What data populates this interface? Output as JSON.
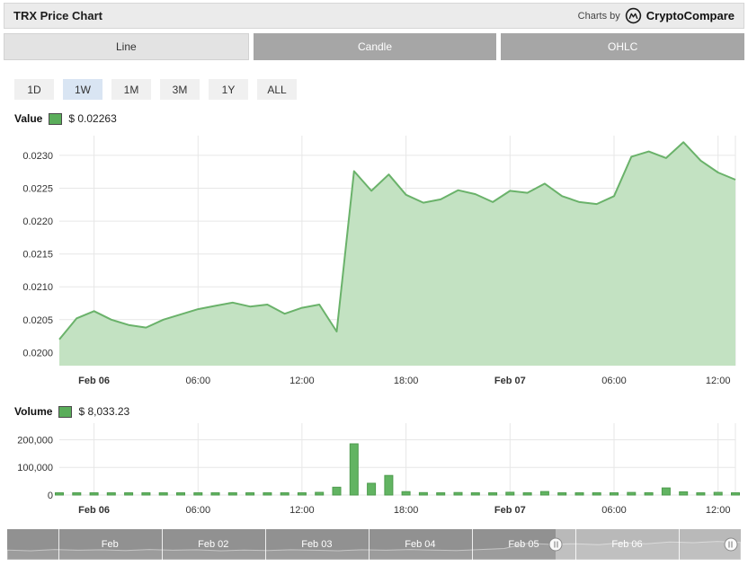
{
  "header": {
    "title": "TRX Price Chart",
    "charts_by": "Charts by",
    "brand": "CryptoCompare"
  },
  "tabs": [
    {
      "label": "Line",
      "active": true
    },
    {
      "label": "Candle",
      "active": false
    },
    {
      "label": "OHLC",
      "active": false
    }
  ],
  "ranges": [
    {
      "label": "1D",
      "selected": false
    },
    {
      "label": "1W",
      "selected": true
    },
    {
      "label": "1M",
      "selected": false
    },
    {
      "label": "3M",
      "selected": false
    },
    {
      "label": "1Y",
      "selected": false
    },
    {
      "label": "ALL",
      "selected": false
    }
  ],
  "price_legend": {
    "label": "Value",
    "value": "$ 0.02263"
  },
  "volume_legend": {
    "label": "Volume",
    "value": "$ 8,033.23"
  },
  "colors": {
    "line": "#6ab26a",
    "area_fill": "#c3e2c2",
    "bar_fill": "#62b462",
    "bar_border": "#4d9b4d",
    "swatch": "#5aad5a",
    "grid": "#e7e7e7",
    "range_selected_bg": "#d9e5f3"
  },
  "chart_data": [
    {
      "type": "area",
      "title": "TRX price (USD)",
      "legend": "Value",
      "x": [
        "Feb 05 22:00",
        "Feb 05 23:00",
        "Feb 06 00:00",
        "01:00",
        "02:00",
        "03:00",
        "04:00",
        "05:00",
        "06:00",
        "07:00",
        "08:00",
        "09:00",
        "10:00",
        "11:00",
        "12:00",
        "13:00",
        "14:00",
        "15:00",
        "16:00",
        "17:00",
        "18:00",
        "19:00",
        "20:00",
        "21:00",
        "22:00",
        "23:00",
        "Feb 07 00:00",
        "01:00",
        "02:00",
        "03:00",
        "04:00",
        "05:00",
        "06:00",
        "07:00",
        "08:00",
        "09:00",
        "10:00",
        "11:00",
        "12:00",
        "13:00"
      ],
      "values": [
        0.0202,
        0.02052,
        0.02063,
        0.0205,
        0.02042,
        0.02038,
        0.0205,
        0.02058,
        0.02066,
        0.02071,
        0.02076,
        0.0207,
        0.02073,
        0.02059,
        0.02068,
        0.02073,
        0.02032,
        0.02276,
        0.02246,
        0.02271,
        0.0224,
        0.02228,
        0.02233,
        0.02247,
        0.02241,
        0.02229,
        0.02246,
        0.02243,
        0.02257,
        0.02238,
        0.02229,
        0.02226,
        0.02238,
        0.02298,
        0.02306,
        0.02296,
        0.0232,
        0.02292,
        0.02274,
        0.02263
      ],
      "ylim": [
        0.0198,
        0.0233
      ],
      "yticks": [
        0.02,
        0.0205,
        0.021,
        0.0215,
        0.022,
        0.0225,
        0.023
      ],
      "xticks": [
        {
          "i": 2,
          "label": "Feb 06",
          "bold": true
        },
        {
          "i": 8,
          "label": "06:00",
          "bold": false
        },
        {
          "i": 14,
          "label": "12:00",
          "bold": false
        },
        {
          "i": 20,
          "label": "18:00",
          "bold": false
        },
        {
          "i": 26,
          "label": "Feb 07",
          "bold": true
        },
        {
          "i": 32,
          "label": "06:00",
          "bold": false
        },
        {
          "i": 38,
          "label": "12:00",
          "bold": false
        }
      ],
      "grid": true
    },
    {
      "type": "bar",
      "title": "Volume (USD)",
      "legend": "Volume",
      "x": [
        "Feb 05 22:00",
        "Feb 05 23:00",
        "Feb 06 00:00",
        "01:00",
        "02:00",
        "03:00",
        "04:00",
        "05:00",
        "06:00",
        "07:00",
        "08:00",
        "09:00",
        "10:00",
        "11:00",
        "12:00",
        "13:00",
        "14:00",
        "15:00",
        "16:00",
        "17:00",
        "18:00",
        "19:00",
        "20:00",
        "21:00",
        "22:00",
        "23:00",
        "Feb 07 00:00",
        "01:00",
        "02:00",
        "03:00",
        "04:00",
        "05:00",
        "06:00",
        "07:00",
        "08:00",
        "09:00",
        "10:00",
        "11:00",
        "12:00",
        "13:00"
      ],
      "values": [
        4800,
        6200,
        8100,
        5300,
        7700,
        4100,
        3500,
        5900,
        4700,
        3300,
        6000,
        4400,
        7100,
        5200,
        4900,
        9700,
        28400,
        185300,
        42600,
        70900,
        12300,
        8700,
        6100,
        9200,
        7400,
        5700,
        10100,
        6800,
        12700,
        7600,
        4200,
        3900,
        6900,
        9500,
        8300,
        25600,
        11800,
        7500,
        9600,
        8033.23
      ],
      "ylim": [
        0,
        260000
      ],
      "yticks": [
        0,
        100000,
        200000
      ],
      "xticks": [
        {
          "i": 2,
          "label": "Feb 06",
          "bold": true
        },
        {
          "i": 8,
          "label": "06:00",
          "bold": false
        },
        {
          "i": 14,
          "label": "12:00",
          "bold": false
        },
        {
          "i": 20,
          "label": "18:00",
          "bold": false
        },
        {
          "i": 26,
          "label": "Feb 07",
          "bold": true
        },
        {
          "i": 32,
          "label": "06:00",
          "bold": false
        },
        {
          "i": 38,
          "label": "12:00",
          "bold": false
        }
      ],
      "grid": true
    }
  ],
  "navigator": {
    "labels": [
      "Feb",
      "Feb 02",
      "Feb 03",
      "Feb 04",
      "Feb 05",
      "Feb 06"
    ],
    "label_pcts": [
      14,
      28.1,
      42.2,
      56.3,
      70.4,
      84.5
    ],
    "divider_pcts": [
      7.0,
      21.1,
      35.2,
      49.3,
      63.4,
      77.5,
      91.6
    ],
    "selected_start_pct": 74.8,
    "handle_pcts": [
      74.8,
      98.6
    ],
    "sparkline": [
      0.28,
      0.25,
      0.3,
      0.27,
      0.29,
      0.26,
      0.3,
      0.27,
      0.29,
      0.25,
      0.28,
      0.26,
      0.29,
      0.27,
      0.25,
      0.29,
      0.27,
      0.3,
      0.28,
      0.26,
      0.3,
      0.34,
      0.55,
      0.5,
      0.53,
      0.49,
      0.57,
      0.53,
      0.6,
      0.57,
      0.62,
      0.58
    ]
  }
}
